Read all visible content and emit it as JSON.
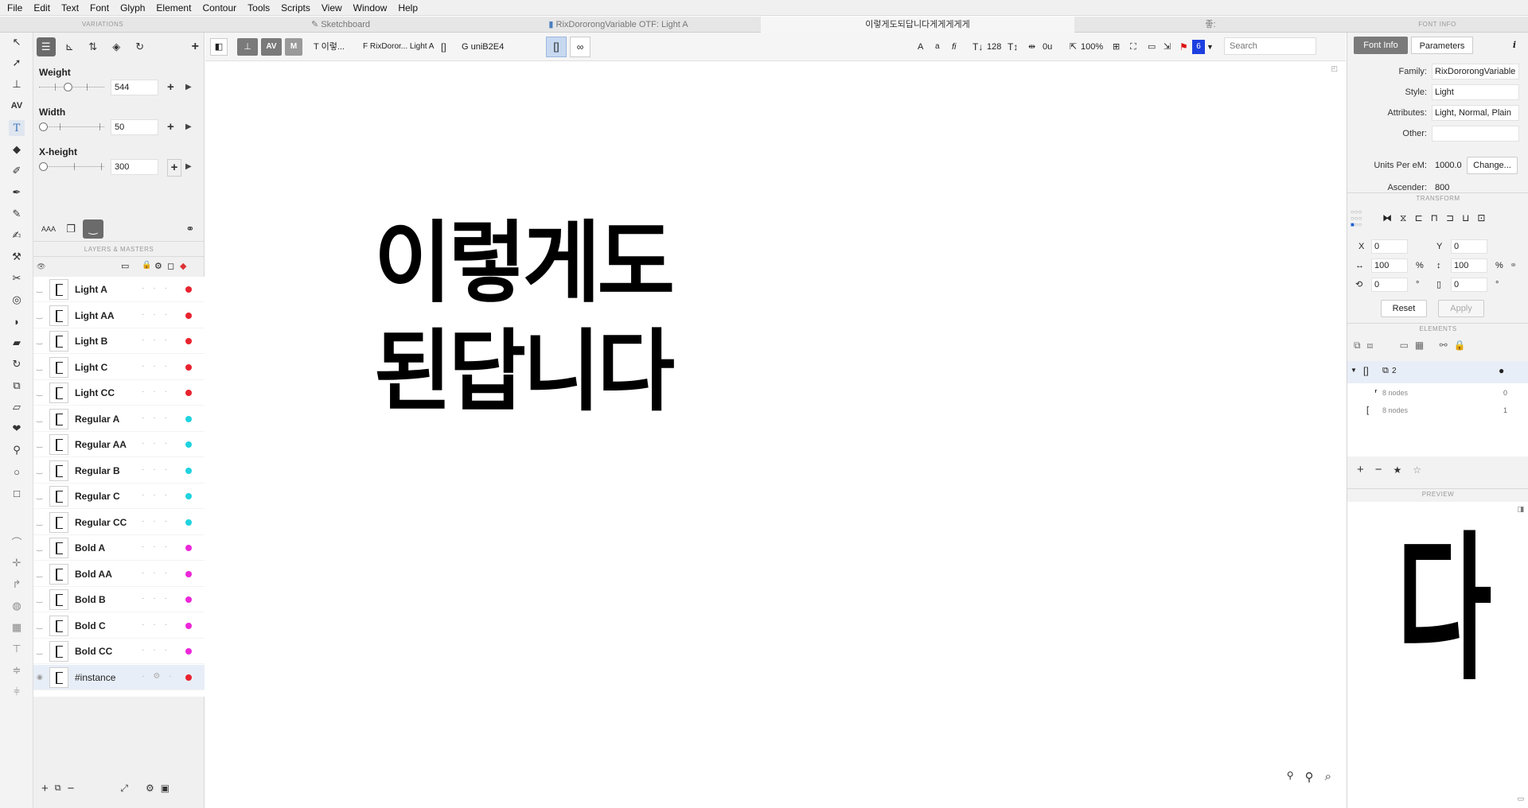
{
  "menu": [
    "File",
    "Edit",
    "Text",
    "Font",
    "Glyph",
    "Element",
    "Contour",
    "Tools",
    "Scripts",
    "View",
    "Window",
    "Help"
  ],
  "tabs": {
    "variations": "VARIATIONS",
    "sketchboard": "Sketchboard",
    "font_file": "RixDororongVariable OTF: Light A",
    "text_tab": "이렇게도되답니다게게게게게",
    "glyph_tab": "좋:",
    "font_info": "FONT INFO"
  },
  "variations": {
    "axes": [
      {
        "name": "Weight",
        "value": "544",
        "level": 0.44
      },
      {
        "name": "Width",
        "value": "50",
        "level": 0.0
      },
      {
        "name": "X-height",
        "value": "300",
        "level": 0.0
      }
    ],
    "layers_header": "LAYERS & MASTERS",
    "layers": [
      {
        "name": "Light A",
        "color": "#e8232e"
      },
      {
        "name": "Light AA",
        "color": "#e8232e"
      },
      {
        "name": "Light B",
        "color": "#e8232e"
      },
      {
        "name": "Light C",
        "color": "#e8232e"
      },
      {
        "name": "Light CC",
        "color": "#e8232e"
      },
      {
        "name": "Regular A",
        "color": "#1fd3df"
      },
      {
        "name": "Regular AA",
        "color": "#1fd3df"
      },
      {
        "name": "Regular B",
        "color": "#1fd3df"
      },
      {
        "name": "Regular C",
        "color": "#1fd3df"
      },
      {
        "name": "Regular CC",
        "color": "#1fd3df"
      },
      {
        "name": "Bold A",
        "color": "#ec27d8"
      },
      {
        "name": "Bold AA",
        "color": "#ec27d8"
      },
      {
        "name": "Bold B",
        "color": "#ec27d8"
      },
      {
        "name": "Bold C",
        "color": "#ec27d8"
      },
      {
        "name": "Bold CC",
        "color": "#ec27d8"
      },
      {
        "name": "#instance",
        "color": "#e8232e"
      }
    ]
  },
  "editbar": {
    "text_field": "T 이렇...",
    "font_field": "F RixDoror... Light A",
    "glyph_field": "G uniB2E4",
    "font_size": "128",
    "tracking": "0u",
    "zoom": "100%",
    "search_placeholder": "Search",
    "flag_count": "6"
  },
  "canvas": {
    "line1": "이렇게도",
    "line2": "된답니다"
  },
  "fontinfo": {
    "tab_font_info": "Font Info",
    "tab_parameters": "Parameters",
    "family_label": "Family:",
    "family": "RixDororongVariable OTF",
    "style_label": "Style:",
    "style": "Light",
    "attributes_label": "Attributes:",
    "attributes": "Light, Normal, Plain",
    "other_label": "Other:",
    "other": "",
    "upm_label": "Units Per eM:",
    "upm": "1000.0",
    "change_button": "Change...",
    "ascender_label": "Ascender:",
    "ascender": "800"
  },
  "transform": {
    "title": "TRANSFORM",
    "x": "0",
    "y": "0",
    "w": "100",
    "h": "100",
    "rot": "0",
    "skew": "0",
    "reset": "Reset",
    "apply": "Apply"
  },
  "elements": {
    "title": "ELEMENTS",
    "group_count": "2",
    "rows": [
      {
        "label": "8 nodes",
        "index": "0"
      },
      {
        "label": "8 nodes",
        "index": "1"
      }
    ]
  },
  "preview": {
    "title": "PREVIEW",
    "glyph": "다"
  }
}
